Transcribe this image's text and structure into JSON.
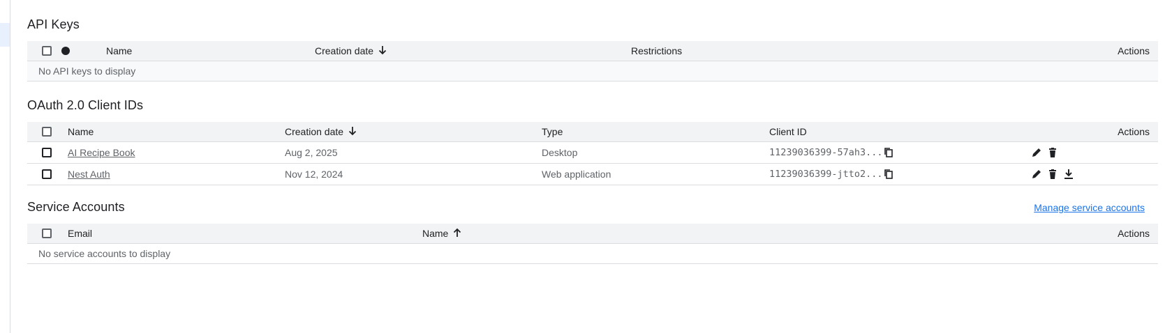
{
  "api_keys": {
    "title": "API Keys",
    "headers": {
      "name": "Name",
      "creation_date": "Creation date",
      "restrictions": "Restrictions",
      "actions": "Actions"
    },
    "empty_message": "No API keys to display"
  },
  "oauth": {
    "title": "OAuth 2.0 Client IDs",
    "headers": {
      "name": "Name",
      "creation_date": "Creation date",
      "type": "Type",
      "client_id": "Client ID",
      "actions": "Actions"
    },
    "rows": [
      {
        "name": "AI Recipe Book",
        "creation_date": "Aug 2, 2025",
        "type": "Desktop",
        "client_id": "11239036399-57ah3..."
      },
      {
        "name": "Nest Auth",
        "creation_date": "Nov 12, 2024",
        "type": "Web application",
        "client_id": "11239036399-jtto2..."
      }
    ]
  },
  "service_accounts": {
    "title": "Service Accounts",
    "manage_link": "Manage service accounts",
    "headers": {
      "email": "Email",
      "name": "Name",
      "actions": "Actions"
    },
    "empty_message": "No service accounts to display"
  },
  "colors": {
    "link": "#1a73e8",
    "header_bg": "#f1f3f4",
    "divider": "#dadce0",
    "text_secondary": "#5f6368"
  },
  "icons": {
    "sort_desc": "arrow-down-icon",
    "sort_asc": "arrow-up-icon",
    "copy": "copy-icon",
    "edit": "pencil-icon",
    "delete": "trash-icon",
    "download": "download-icon"
  }
}
